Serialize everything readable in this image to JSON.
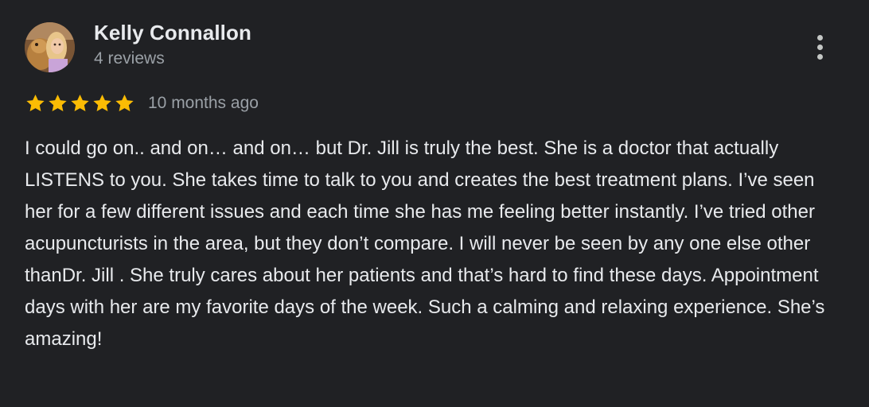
{
  "reviewer": {
    "name": "Kelly Connallon",
    "review_count": "4 reviews",
    "avatar_icon": "profile-photo"
  },
  "rating": {
    "stars": 5,
    "max_stars": 5,
    "star_color": "#fbbc04",
    "time": "10 months ago"
  },
  "review": {
    "text": "I could go on.. and on… and on… but Dr. Jill is truly the best. She is a doctor that actually LISTENS to you. She takes time to talk to you and creates the best treatment plans. I’ve seen her for a few different issues and each time she has me feeling better instantly. I’ve tried other acupuncturists in the area, but they don’t compare. I will never be seen by any one else other thanDr. Jill . She truly cares about her patients and that’s hard to find these days. Appointment days with her are my favorite days of the week. Such a calming and relaxing experience. She’s amazing!"
  },
  "actions": {
    "more_icon": "more-vert-icon"
  },
  "colors": {
    "background": "#202124",
    "primary_text": "#e8eaed",
    "secondary_text": "#9aa0a6"
  }
}
